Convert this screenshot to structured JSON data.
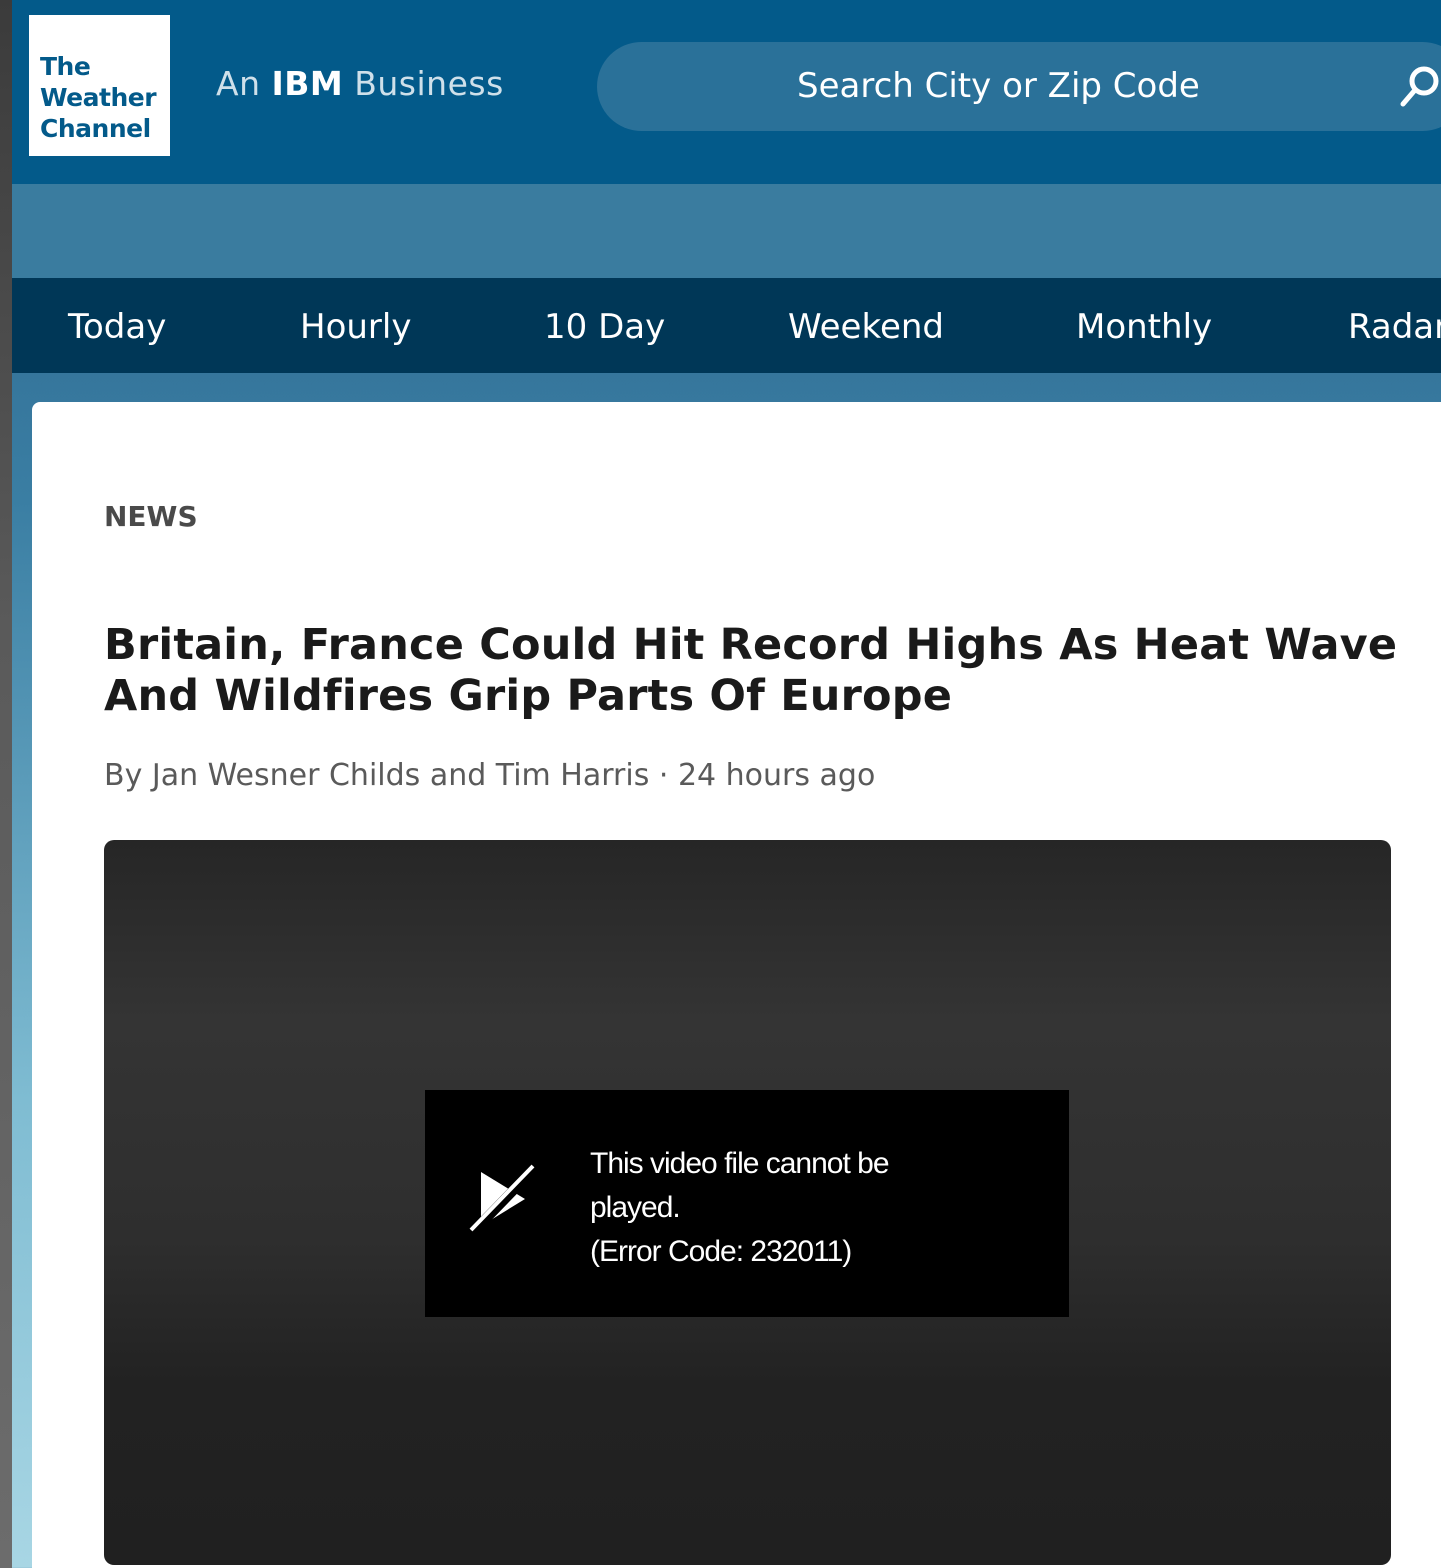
{
  "header": {
    "logo": {
      "line1": "The",
      "line2": "Weather",
      "line3": "Channel"
    },
    "tagline_prefix": "An ",
    "tagline_brand": "IBM",
    "tagline_suffix": " Business",
    "search": {
      "placeholder": "Search City or Zip Code",
      "icon": "search-icon"
    }
  },
  "nav": {
    "items": [
      {
        "label": "Today"
      },
      {
        "label": "Hourly"
      },
      {
        "label": "10 Day"
      },
      {
        "label": "Weekend"
      },
      {
        "label": "Monthly"
      },
      {
        "label": "Radar"
      }
    ]
  },
  "article": {
    "category": "NEWS",
    "headline": "Britain, France Could Hit Record Highs As Heat Wave And Wildfires Grip Parts Of Europe",
    "byline": "By Jan Wesner Childs and Tim Harris · 24 hours ago"
  },
  "video": {
    "error_line1": "This video file cannot be",
    "error_line2": "played.",
    "error_line3": "(Error Code: 232011)",
    "icon": "broken-play-icon"
  },
  "colors": {
    "header_bg": "#035a8a",
    "subbar_bg": "#3a7c9f",
    "nav_bg": "#003757",
    "search_bg": "#2a7199"
  }
}
